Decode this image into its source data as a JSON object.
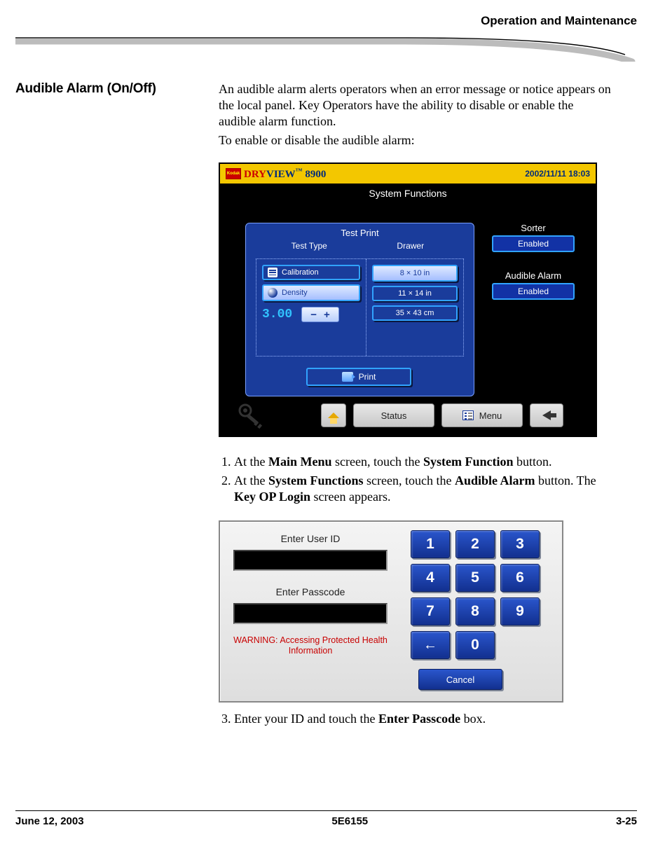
{
  "header": {
    "chapter": "Operation and Maintenance"
  },
  "section": {
    "heading": "Audible Alarm (On/Off)",
    "p1": "An audible alarm alerts operators when an error message or notice appears on the local panel. Key Operators have the ability to disable or enable the audible alarm function.",
    "p2": "To enable or disable the audible alarm:"
  },
  "steps": {
    "s1_a": "At the ",
    "s1_b": "Main Menu",
    "s1_c": " screen, touch the ",
    "s1_d": "System Function",
    "s1_e": " button.",
    "s2_a": "At the ",
    "s2_b": "System Functions",
    "s2_c": " screen, touch the ",
    "s2_d": "Audible Alarm",
    "s2_e": " button. The ",
    "s2_f": "Key OP Login",
    "s2_g": " screen appears.",
    "s3_a": "Enter your ID and touch the ",
    "s3_b": "Enter Passcode",
    "s3_c": " box."
  },
  "shot1": {
    "product_dry": "DRY",
    "product_view": "VIEW",
    "product_tm": "™",
    "product_num": "8900",
    "kodak": "Kodak",
    "timestamp": "2002/11/11 18:03",
    "title": "System Functions",
    "panel_title": "Test Print",
    "col1": "Test Type",
    "col2": "Drawer",
    "calibration": "Calibration",
    "density": "Density",
    "density_val": "3.00",
    "minus": "−",
    "plus": "+",
    "drawer1": "8 × 10 in",
    "drawer2": "11 × 14 in",
    "drawer3": "35 × 43 cm",
    "print": "Print",
    "sorter_label": "Sorter",
    "sorter_val": "Enabled",
    "alarm_label": "Audible Alarm",
    "alarm_val": "Enabled",
    "status": "Status",
    "menu": "Menu"
  },
  "shot2": {
    "user_label": "Enter User ID",
    "pass_label": "Enter Passcode",
    "warning": "WARNING: Accessing Protected Health Information",
    "k1": "1",
    "k2": "2",
    "k3": "3",
    "k4": "4",
    "k5": "5",
    "k6": "6",
    "k7": "7",
    "k8": "8",
    "k9": "9",
    "k0": "0",
    "back": "←",
    "cancel": "Cancel"
  },
  "footer": {
    "date": "June 12, 2003",
    "doc": "5E6155",
    "page": "3-25"
  }
}
